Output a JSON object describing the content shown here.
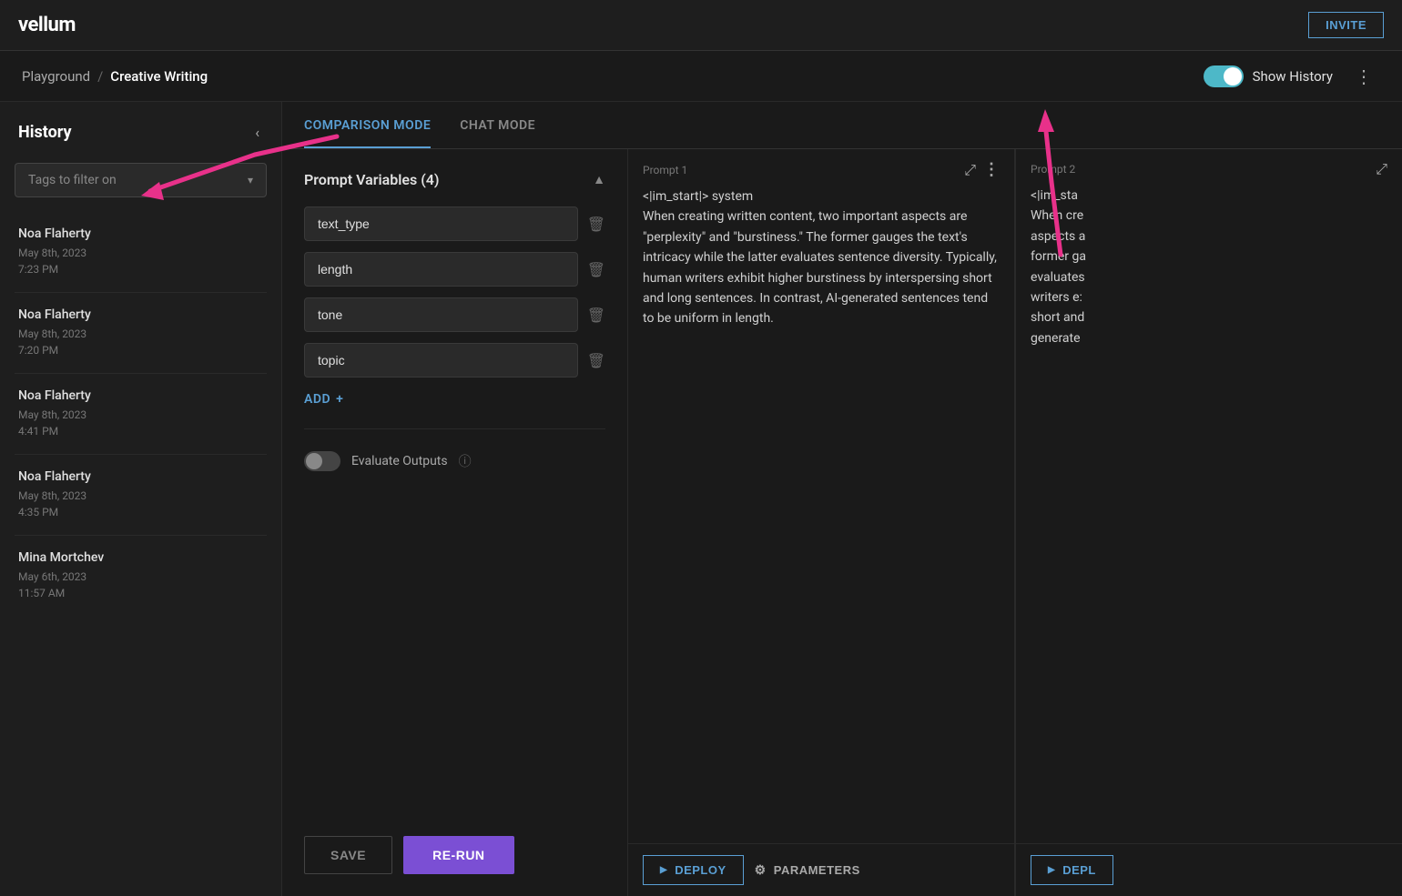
{
  "app": {
    "logo": "vellum",
    "invite_label": "INVITE"
  },
  "breadcrumb": {
    "parent": "Playground",
    "separator": "/",
    "current": "Creative Writing"
  },
  "show_history": {
    "label": "Show History"
  },
  "tabs": [
    {
      "id": "comparison",
      "label": "COMPARISON MODE",
      "active": true
    },
    {
      "id": "chat",
      "label": "CHAT MODE",
      "active": false
    }
  ],
  "sidebar": {
    "title": "History",
    "tags_placeholder": "Tags to filter on",
    "items": [
      {
        "name": "Noa Flaherty",
        "date": "May 8th, 2023",
        "time": "7:23 PM"
      },
      {
        "name": "Noa Flaherty",
        "date": "May 8th, 2023",
        "time": "7:20 PM"
      },
      {
        "name": "Noa Flaherty",
        "date": "May 8th, 2023",
        "time": "4:41 PM"
      },
      {
        "name": "Noa Flaherty",
        "date": "May 8th, 2023",
        "time": "4:35 PM"
      },
      {
        "name": "Mina Mortchev",
        "date": "May 6th, 2023",
        "time": "11:57 AM"
      }
    ]
  },
  "prompt_variables": {
    "title": "Prompt Variables (4)",
    "items": [
      {
        "value": "text_type"
      },
      {
        "value": "length"
      },
      {
        "value": "tone"
      },
      {
        "value": "topic"
      }
    ],
    "add_label": "ADD"
  },
  "evaluate": {
    "label": "Evaluate Outputs"
  },
  "actions": {
    "save_label": "SAVE",
    "rerun_label": "RE-RUN"
  },
  "prompt1": {
    "label": "Prompt 1",
    "content": "<|im_start|> system\nWhen creating written content, two important aspects are \"perplexity\" and \"burstiness.\" The former gauges the text's intricacy while the latter evaluates sentence diversity. Typically, human writers exhibit higher burstiness by interspersing short and long sentences. In contrast, AI-generated sentences tend to be uniform in length.",
    "deploy_label": "DEPLOY",
    "parameters_label": "PARAMETERS"
  },
  "prompt2": {
    "label": "Prompt 2",
    "content": "<|im_sta\nWhen cre\naspects a\nformer ga\nevaluates\nwriters e:\nshort and\ngenerate",
    "deploy_label": "DEPL"
  },
  "icons": {
    "collapse": "‹",
    "chevron_down": "▾",
    "expand": "⤢",
    "more_vert": "⋮",
    "play": "▶",
    "gear": "⚙",
    "plus": "+",
    "trash": "🗑",
    "info": "ⓘ"
  },
  "colors": {
    "accent_blue": "#5a9fd4",
    "accent_teal": "#4db8c8",
    "accent_purple": "#7b4fd4",
    "pink_arrow": "#e8318a",
    "bg_dark": "#1a1a1a",
    "bg_panel": "#1e1e1e",
    "border": "#2a2a2a"
  }
}
